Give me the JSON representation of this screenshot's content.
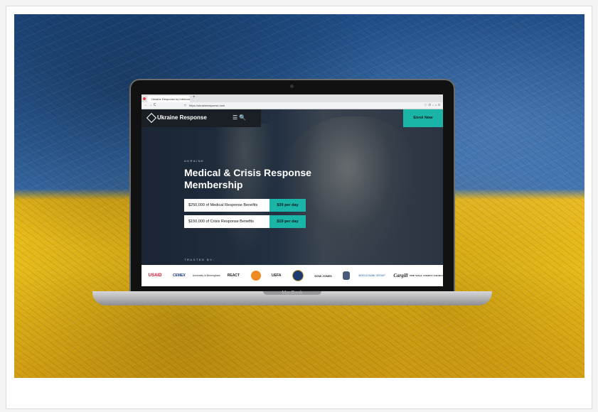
{
  "browser": {
    "tab_title": "Ukraine Response by Interlock",
    "tab_new": "+",
    "nav_buttons": "← → C",
    "url": "https://ukraineresponse.com",
    "right_icons": "☆    ⊙ ↓ ⌂ ≡"
  },
  "site": {
    "logo": "Ukraine Response",
    "nav_icons": "☰ 🔍",
    "cta": "Enrol Now",
    "eyebrow": "UKRAINE",
    "headline": "Medical & Crisis Response Membership",
    "offers": [
      {
        "text": "$250,000 of Medical Response Benefits",
        "price": "$39 per day"
      },
      {
        "text": "$150,000 of Crisis Response Benefits",
        "price": "$19 per day"
      }
    ],
    "trusted_label": "TRUSTED BY:",
    "logos": [
      "USAID",
      "CEMEX",
      "University of Birmingham",
      "REACT",
      "",
      "UEFA",
      "",
      "DOW JONES",
      "",
      "WORLD BANK GROUP",
      "Cargill",
      "THE WALL STREET JOURNAL"
    ]
  },
  "device": {
    "label": "MacBook"
  },
  "colors": {
    "accent": "#1bb5a8",
    "flag_blue": "#2f64a4",
    "flag_yellow": "#f1c51d"
  }
}
